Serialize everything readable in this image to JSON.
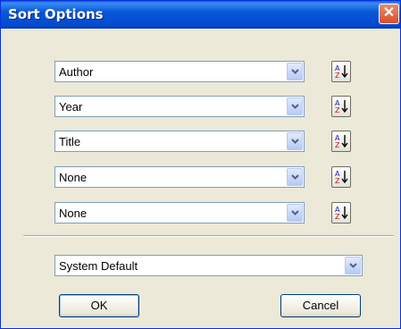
{
  "window": {
    "title": "Sort Options",
    "close_label": "✕"
  },
  "sort_fields": [
    {
      "value": "Author",
      "direction_icon": "sort-az-icon"
    },
    {
      "value": "Year",
      "direction_icon": "sort-az-icon"
    },
    {
      "value": "Title",
      "direction_icon": "sort-az-icon"
    },
    {
      "value": "None",
      "direction_icon": "sort-az-icon"
    },
    {
      "value": "None",
      "direction_icon": "sort-az-icon"
    }
  ],
  "locale_select": {
    "value": "System Default"
  },
  "buttons": {
    "ok": "OK",
    "cancel": "Cancel"
  },
  "colors": {
    "titlebar": "#0758d8",
    "dialog_bg": "#ece9d8",
    "close": "#d8502b"
  }
}
